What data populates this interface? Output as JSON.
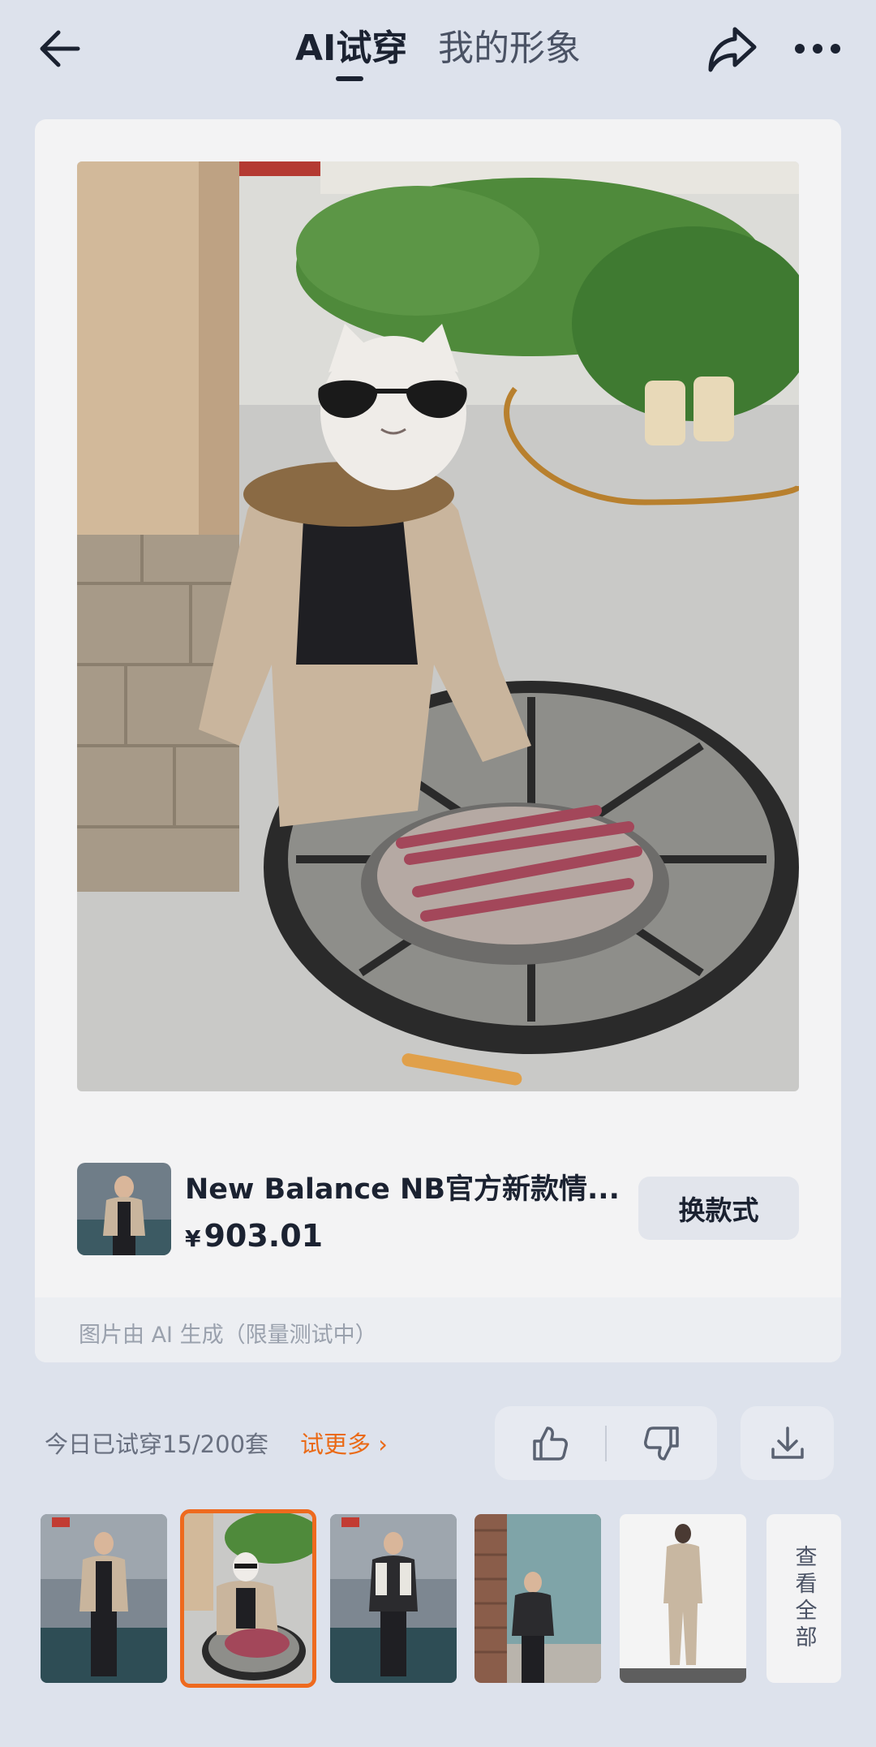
{
  "header": {
    "tab_active": "AI试穿",
    "tab_inactive": "我的形象"
  },
  "product": {
    "name": "New Balance NB官方新款情...",
    "currency": "¥",
    "price": "903.01",
    "change_button": "换款式"
  },
  "card": {
    "ai_note": "图片由 AI 生成（限量测试中）"
  },
  "stats": {
    "usage": "今日已试穿15/200套",
    "try_more": "试更多 ›"
  },
  "thumbnails": {
    "view_all": "查看全部",
    "selected_index": 1
  },
  "colors": {
    "background": "#dde2ec",
    "accent": "#ee6a1e",
    "card": "#f3f3f4"
  }
}
